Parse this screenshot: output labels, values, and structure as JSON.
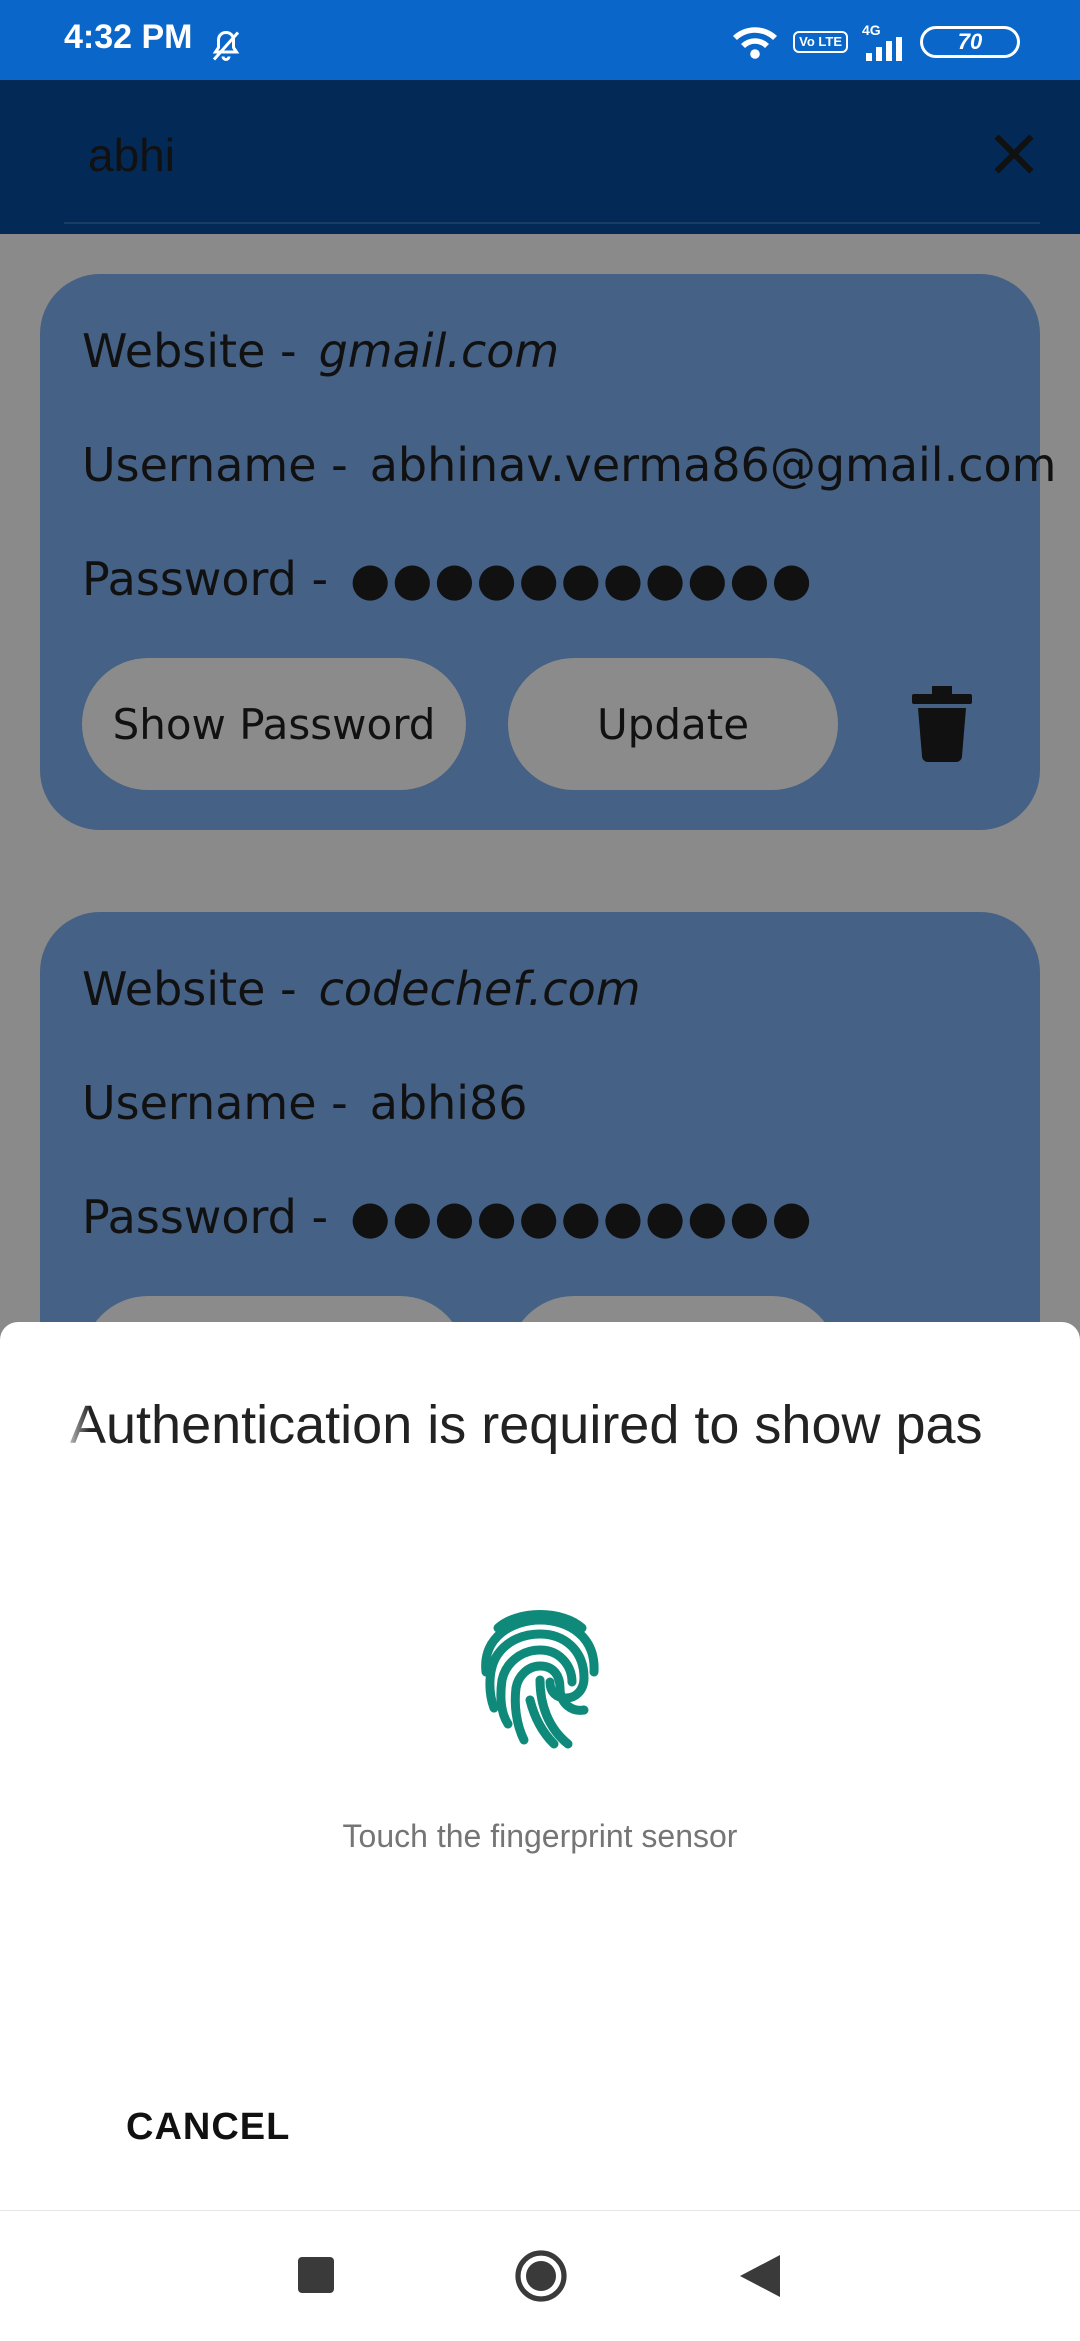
{
  "status": {
    "time": "4:32 PM",
    "network": "4G",
    "lte": "Vo LTE",
    "battery": "70"
  },
  "search": {
    "query": "abhi"
  },
  "cards": [
    {
      "website_label": "Website -",
      "website": "gmail.com",
      "username_label": "Username -",
      "username": "abhinav.verma86@gmail.com",
      "password_label": "Password -",
      "password": "●●●●●●●●●●●",
      "show_password": "Show Password",
      "update": "Update"
    },
    {
      "website_label": "Website -",
      "website": "codechef.com",
      "username_label": "Username -",
      "username": "abhi86",
      "password_label": "Password -",
      "password": "●●●●●●●●●●●"
    }
  ],
  "dialog": {
    "title": "Authentication is required to show pas",
    "hint": "Touch the fingerprint sensor",
    "cancel": "CANCEL"
  },
  "colors": {
    "status_bar": "#0a66c8",
    "toolbar": "#032a57",
    "card": "#456185",
    "fingerprint": "#0f8a7a"
  }
}
